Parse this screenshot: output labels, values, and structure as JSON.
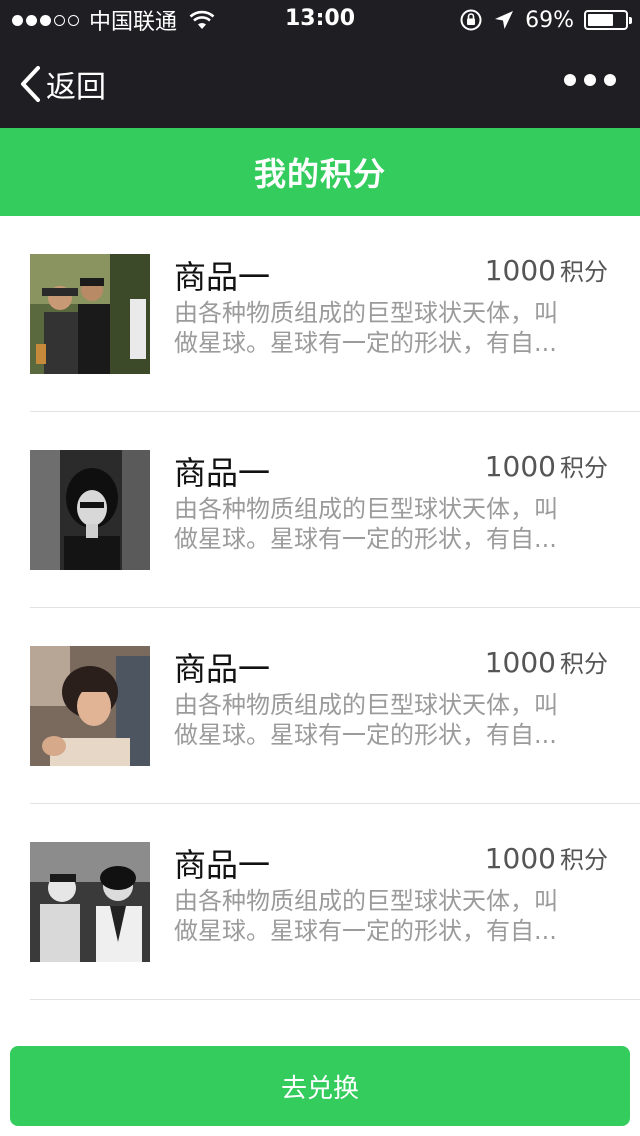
{
  "status_bar": {
    "carrier": "中国联通",
    "time": "13:00",
    "battery": "69%",
    "battery_level": 0.69,
    "icons": [
      "signal-dots-icon",
      "wifi-icon",
      "orientation-lock-icon",
      "location-arrow-icon",
      "battery-icon"
    ]
  },
  "nav": {
    "back_label": "返回",
    "back_icon": "chevron-left-icon",
    "more_icon": "more-dots-icon"
  },
  "page": {
    "title": "我的积分"
  },
  "items": [
    {
      "title": "商品一",
      "points": "1000",
      "points_unit": "积分",
      "desc_line1": "由各种物质组成的巨型球状天体，叫",
      "desc_line2": "做星球。星球有一定的形状，有自..."
    },
    {
      "title": "商品一",
      "points": "1000",
      "points_unit": "积分",
      "desc_line1": "由各种物质组成的巨型球状天体，叫",
      "desc_line2": "做星球。星球有一定的形状，有自..."
    },
    {
      "title": "商品一",
      "points": "1000",
      "points_unit": "积分",
      "desc_line1": "由各种物质组成的巨型球状天体，叫",
      "desc_line2": "做星球。星球有一定的形状，有自..."
    },
    {
      "title": "商品一",
      "points": "1000",
      "points_unit": "积分",
      "desc_line1": "由各种物质组成的巨型球状天体，叫",
      "desc_line2": "做星球。星球有一定的形状，有自..."
    }
  ],
  "footer": {
    "exchange_label": "去兑换"
  },
  "colors": {
    "accent": "#35cc5e",
    "nav_bg": "#1f1f23"
  }
}
